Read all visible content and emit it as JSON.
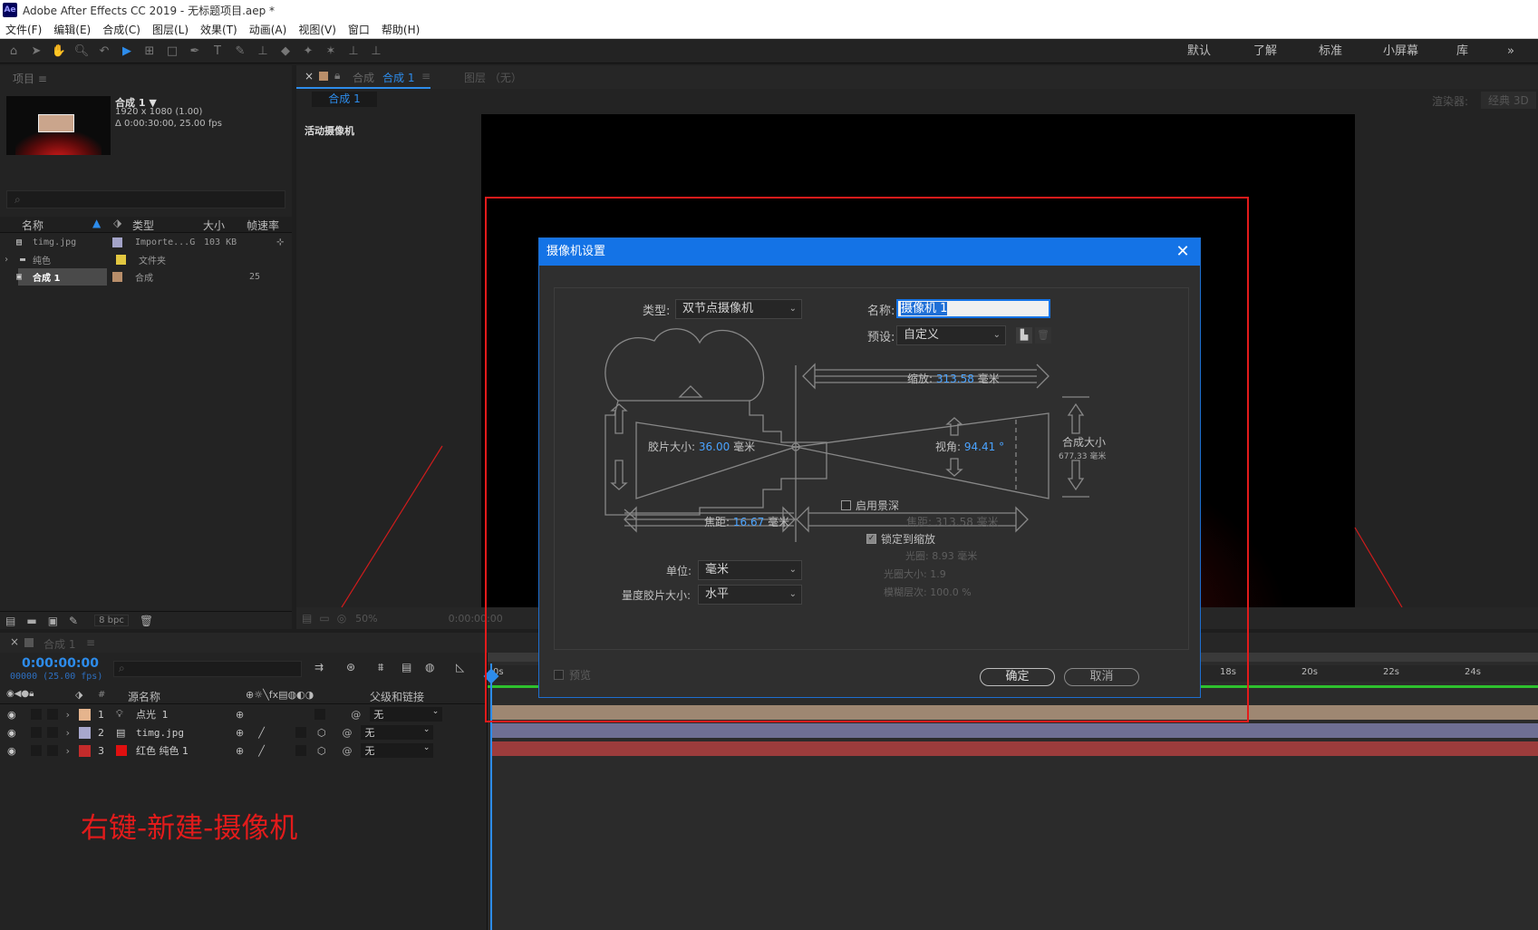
{
  "app": {
    "logo": "Ae",
    "title": "Adobe After Effects CC 2019 - 无标题项目.aep *"
  },
  "menu": [
    "文件(F)",
    "编辑(E)",
    "合成(C)",
    "图层(L)",
    "效果(T)",
    "动画(A)",
    "视图(V)",
    "窗口",
    "帮助(H)"
  ],
  "workspaces": [
    "默认",
    "了解",
    "标准",
    "小屏幕",
    "库",
    "»"
  ],
  "project": {
    "tab": "项目 ≡",
    "comp_name": "合成 1",
    "comp_res": "1920 x 1080 (1.00)",
    "comp_dur": "Δ 0:00:30:00, 25.00 fps",
    "search_placeholder": "",
    "cols": {
      "name": "名称",
      "type": "类型",
      "size": "大小",
      "fps": "帧速率"
    },
    "items": [
      {
        "name": "timg.jpg",
        "type": "Importe...G",
        "size": "103 KB",
        "fps": "",
        "color": "#a3a3c8"
      },
      {
        "name": "纯色",
        "type": "文件夹",
        "size": "",
        "fps": "",
        "color": "#e2c740"
      },
      {
        "name": "合成 1",
        "type": "合成",
        "size": "",
        "fps": "25",
        "color": "#b88e6a"
      }
    ],
    "bpc": "8 bpc"
  },
  "comp_panel": {
    "tab_prefix": "合成",
    "tab_name": "合成 1",
    "layer_tab": "图层 （无）",
    "subtab": "合成 1",
    "renderer_label": "渲染器:",
    "renderer_value": "经典 3D",
    "camera_label": "活动摄像机",
    "zoom": "50%",
    "timecode": "0:00:00:00"
  },
  "dialog": {
    "title": "摄像机设置",
    "type_label": "类型:",
    "type_value": "双节点摄像机",
    "name_label": "名称:",
    "name_value": "摄像机 1",
    "preset_label": "预设:",
    "preset_value": "自定义",
    "zoom_label": "缩放:",
    "zoom_value": "313.58",
    "zoom_unit": "毫米",
    "film_label": "胶片大小:",
    "film_value": "36.00",
    "film_unit": "毫米",
    "angle_label": "视角:",
    "angle_value": "94.41",
    "angle_unit": "°",
    "comp_size_label": "合成大小",
    "comp_size_value": "677.33 毫米",
    "dof_label": "启用景深",
    "focal_label": "焦距:",
    "focal_value": "16.67",
    "focal_unit": "毫米",
    "focus_dist_label": "焦距:",
    "focus_dist_value": "313.58 毫米",
    "lock_label": "锁定到缩放",
    "aperture_label": "光圈:",
    "aperture_value": "8.93 毫米",
    "fstop_label": "光圈大小:",
    "fstop_value": "1.9",
    "blur_label": "模糊层次:",
    "blur_value": "100.0 %",
    "units_label": "单位:",
    "units_value": "毫米",
    "measure_label": "量度胶片大小:",
    "measure_value": "水平",
    "preview_label": "预览",
    "ok": "确定",
    "cancel": "取消"
  },
  "timeline": {
    "tab": "合成 1",
    "timecode": "0:00:00:00",
    "frame_info": "00000 (25.00 fps)",
    "col_num": "#",
    "col_source": "源名称",
    "col_parent": "父级和链接",
    "rulers": [
      "0s",
      "18s",
      "20s",
      "22s",
      "24s"
    ],
    "layers": [
      {
        "num": "1",
        "name": "点光 1",
        "parent": "无",
        "color": "#e5b48d",
        "bar": "#9e8772"
      },
      {
        "num": "2",
        "name": "timg.jpg",
        "parent": "无",
        "color": "#a7a7cd",
        "bar": "#6f6f94"
      },
      {
        "num": "3",
        "name": "红色 纯色 1",
        "parent": "无",
        "color": "#c42b2b",
        "bar": "#9c3c3c"
      }
    ]
  },
  "annotation": "右键-新建-摄像机",
  "colors": {
    "accent": "#1473e6",
    "highlight": "#e21b1b",
    "value_blue": "#4aa3ff"
  }
}
